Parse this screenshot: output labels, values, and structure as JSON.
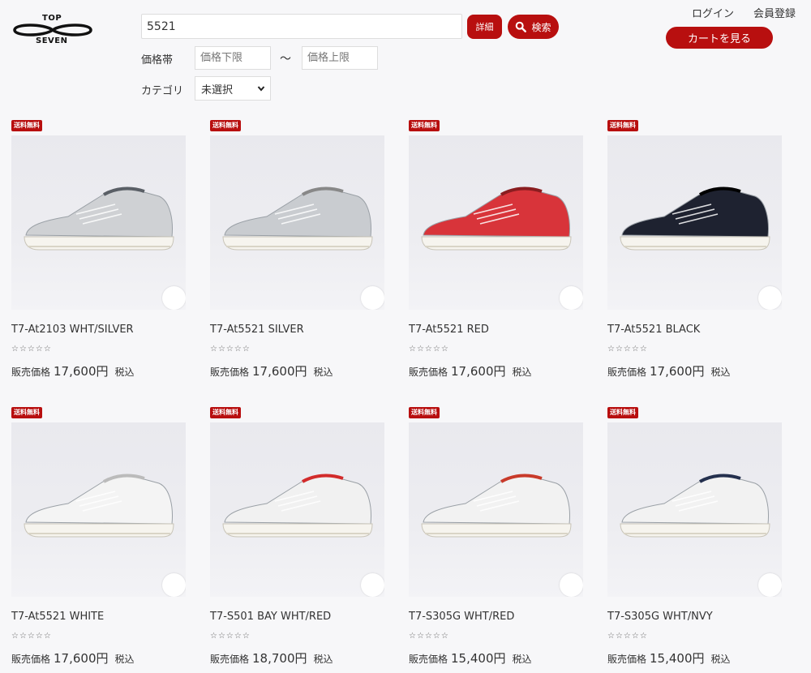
{
  "header": {
    "logo_top": "TOP",
    "logo_bottom": "SEVEN",
    "search_value": "5521",
    "detail_label": "詳細",
    "search_label": "検索",
    "price_label": "価格帯",
    "price_min_placeholder": "価格下限",
    "price_sep": "～",
    "price_max_placeholder": "価格上限",
    "category_label": "カテゴリ",
    "category_selected": "未選択",
    "login": "ログイン",
    "register": "会員登録",
    "cart": "カートを見る"
  },
  "labels": {
    "badge": "送料無料",
    "price_prefix": "販売価格",
    "tax": "税込",
    "stars": "☆☆☆☆☆"
  },
  "products": [
    {
      "name": "T7-At2103 WHT/SILVER",
      "price": "17,600円",
      "color": "#cfd1d4",
      "accent": "#5a5f66"
    },
    {
      "name": "T7-At5521 SILVER",
      "price": "17,600円",
      "color": "#c9ccd0",
      "accent": "#888"
    },
    {
      "name": "T7-At5521 RED",
      "price": "17,600円",
      "color": "#d8343a",
      "accent": "#8a1d20"
    },
    {
      "name": "T7-At5521 BLACK",
      "price": "17,600円",
      "color": "#1e2230",
      "accent": "#000"
    },
    {
      "name": "T7-At5521 WHITE",
      "price": "17,600円",
      "color": "#f4f4f4",
      "accent": "#bbb"
    },
    {
      "name": "T7-S501 BAY WHT/RED",
      "price": "18,700円",
      "color": "#f1f1f1",
      "accent": "#d22b2b"
    },
    {
      "name": "T7-S305G WHT/RED",
      "price": "15,400円",
      "color": "#f2f2f2",
      "accent": "#c83a2a"
    },
    {
      "name": "T7-S305G WHT/NVY",
      "price": "15,400円",
      "color": "#f2f2f2",
      "accent": "#24304e"
    }
  ]
}
